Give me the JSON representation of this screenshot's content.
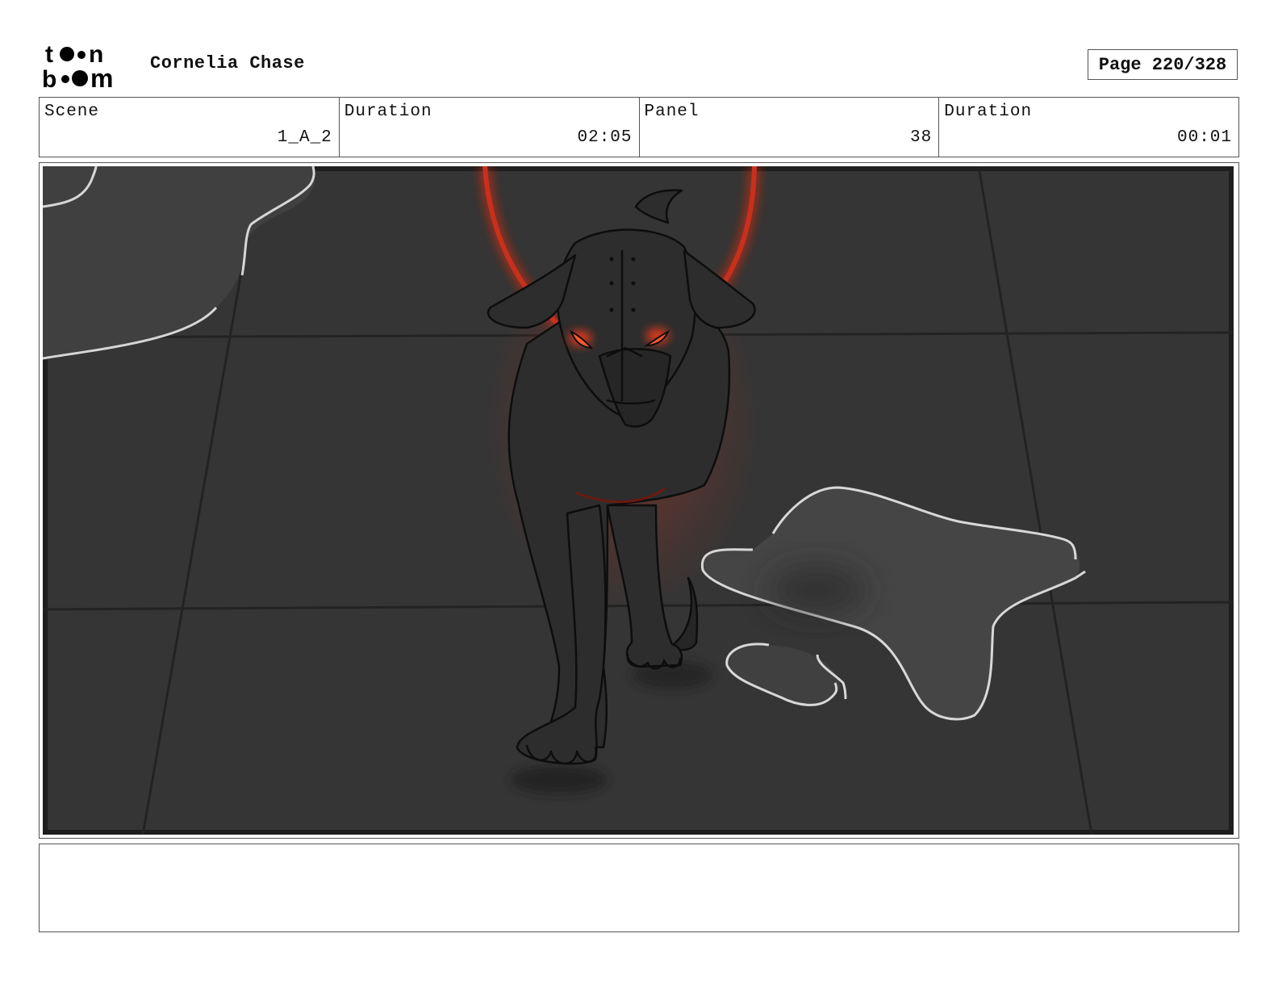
{
  "header": {
    "logo_text": "toon boom",
    "project_title": "Cornelia Chase",
    "page_label": "Page 220/328"
  },
  "info": {
    "scene_label": "Scene",
    "scene_value": "1_A_2",
    "scene_duration_label": "Duration",
    "scene_duration_value": "02:05",
    "panel_label": "Panel",
    "panel_value": "38",
    "panel_duration_label": "Duration",
    "panel_duration_value": "00:01"
  },
  "notes": {
    "text": ""
  },
  "colors": {
    "floor": "#353535",
    "floor_lines": "#222222",
    "puddle": "#454545",
    "puddle_outline": "#d9d9d9",
    "dog_body": "#2b2b2b",
    "glow": "#d22a10",
    "eyes": "#ff4a2a"
  }
}
